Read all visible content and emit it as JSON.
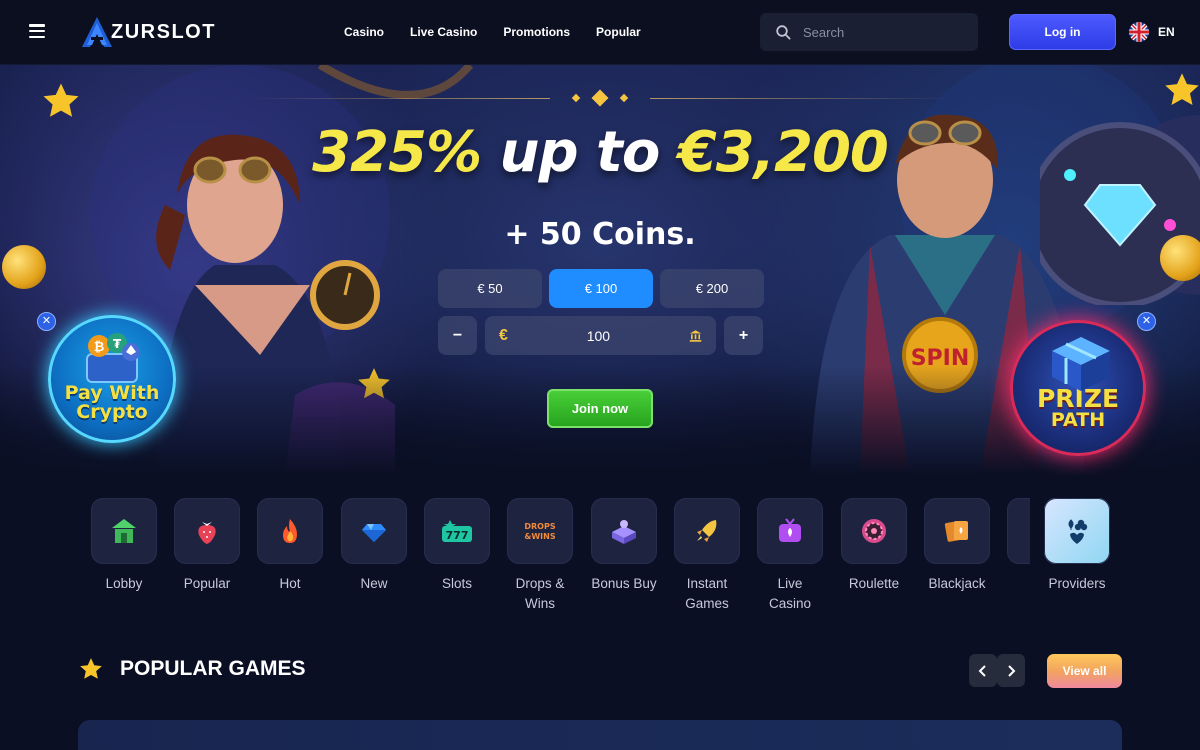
{
  "header": {
    "logo_text": "ZURSLOT",
    "nav": [
      "Casino",
      "Live Casino",
      "Promotions",
      "Popular"
    ],
    "search_placeholder": "Search",
    "login_label": "Log in",
    "language": "EN"
  },
  "hero": {
    "title_part1": "325%",
    "title_part2": "up to",
    "title_part3": "€3,200",
    "subtitle": "+ 50 Coins.",
    "amount_options": [
      "€ 50",
      "€ 100",
      "€ 200"
    ],
    "selected_amount_index": 1,
    "currency_symbol": "€",
    "amount_value": "100",
    "minus_label": "−",
    "plus_label": "+",
    "join_label": "Join now",
    "crypto_badge_line1": "Pay With",
    "crypto_badge_line2": "Crypto",
    "prize_badge_line1": "PRIZE",
    "prize_badge_line2": "PATH",
    "spin_coin_text": "SPIN"
  },
  "categories": [
    {
      "label": "Lobby",
      "icon": "lobby-icon"
    },
    {
      "label": "Popular",
      "icon": "strawberry-icon"
    },
    {
      "label": "Hot",
      "icon": "flame-icon"
    },
    {
      "label": "New",
      "icon": "diamond-icon"
    },
    {
      "label": "Slots",
      "icon": "slot-777-icon"
    },
    {
      "label": "Drops & Wins",
      "icon": "drops-wins-icon"
    },
    {
      "label": "Bonus Buy",
      "icon": "bonus-buy-icon"
    },
    {
      "label": "Instant Games",
      "icon": "rocket-icon"
    },
    {
      "label": "Live Casino",
      "icon": "live-tv-icon"
    },
    {
      "label": "Roulette",
      "icon": "roulette-icon"
    },
    {
      "label": "Blackjack",
      "icon": "cards-icon"
    }
  ],
  "providers_label": "Providers",
  "popular_games": {
    "title": "POPULAR GAMES",
    "view_all_label": "View all"
  },
  "colors": {
    "accent_blue": "#2d3be6",
    "selected_amount": "#1f8cff",
    "join_green": "#26a21d",
    "title_yellow": "#f7e84a"
  }
}
